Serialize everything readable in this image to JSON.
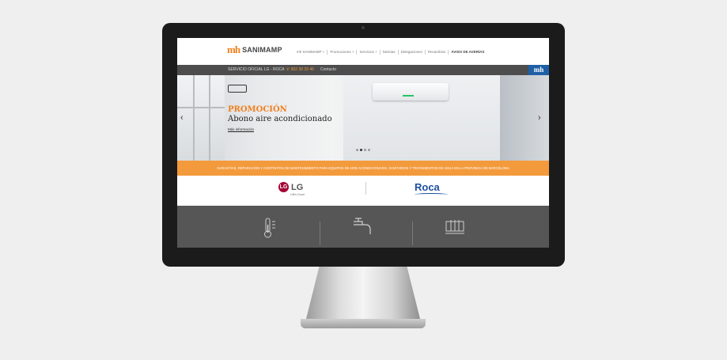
{
  "header": {
    "logo_mark": "mh",
    "logo_text": "SANIMAMP",
    "nav": [
      {
        "label": "mh SANIMAMP +"
      },
      {
        "label": "Promociones +"
      },
      {
        "label": "Servicios +"
      },
      {
        "label": "Noticias"
      },
      {
        "label": "Delegaciones"
      },
      {
        "label": "Recambios"
      },
      {
        "label": "AVISO DE AVERÍAS"
      }
    ]
  },
  "topbar": {
    "service_text": "SERVICIO OFICIAL LG - ROCA",
    "phone": "902 39 33 40",
    "contact": "Contacto",
    "logo_mark": "mh",
    "phone_color": "#f39a3c"
  },
  "hero": {
    "title": "PROMOCIÓN",
    "subtitle": "Abono aire acondicionado",
    "link": "Más información",
    "prev_arrow": "‹",
    "next_arrow": "›",
    "slides_total": 4,
    "slide_active": 1,
    "accent_color": "#f07f1c"
  },
  "strip": {
    "text": "GARANTÍAS, REPARACIÓN Y CONTRATOS DE MANTENIMIENTO PARA EQUIPOS DE AIRE ACONDICIONADO, SANITARIOS Y TRATAMIENTOS DE AGUA EN LA PROVINCIA DE BARCELONA",
    "color": "#f39a3c"
  },
  "brands": {
    "lg_mark": "LG",
    "lg_name": "LG",
    "lg_tagline": "Life's Good",
    "roca_name": "Roca"
  },
  "services": {
    "icons": [
      "thermometer-icon",
      "faucet-icon",
      "water-treatment-icon"
    ]
  }
}
